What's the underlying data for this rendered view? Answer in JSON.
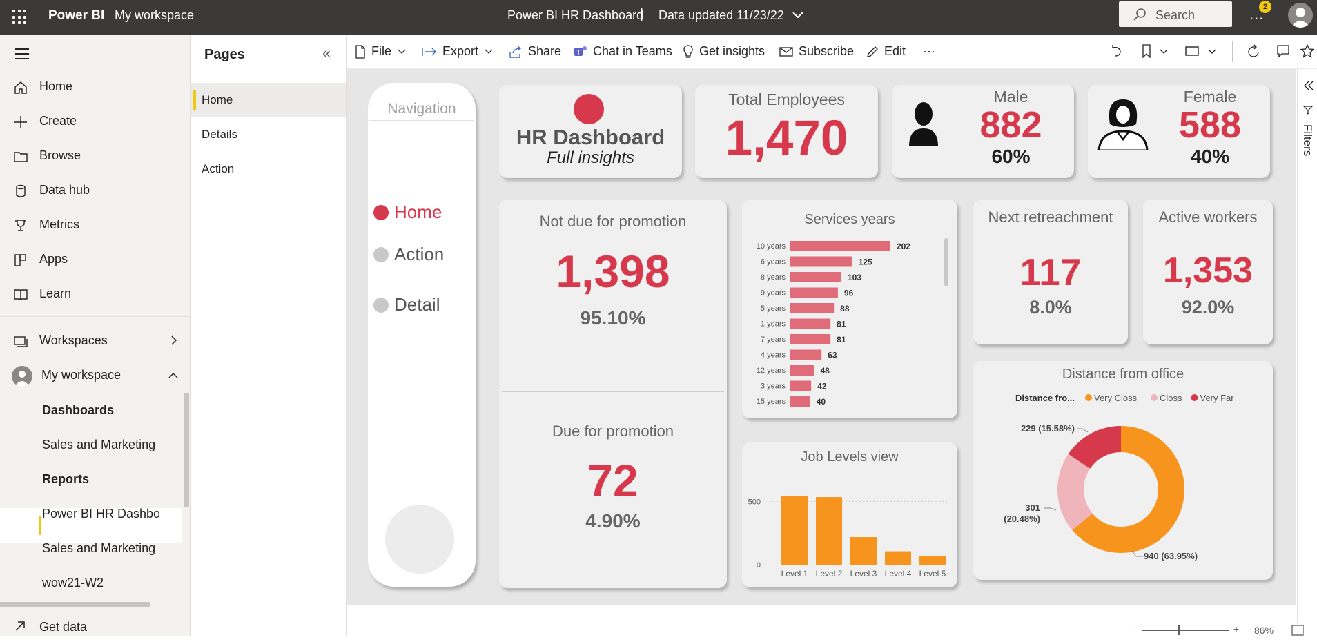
{
  "topbar": {
    "brand": "Power BI",
    "workspace": "My workspace",
    "report_title": "Power BI HR Dashboard",
    "separator": "|",
    "data_updated": "Data updated 11/23/22",
    "search_placeholder": "Search",
    "more": "...",
    "notification_count": "2"
  },
  "leftnav": {
    "items": [
      {
        "label": "Home",
        "icon": "home-icon"
      },
      {
        "label": "Create",
        "icon": "plus-icon"
      },
      {
        "label": "Browse",
        "icon": "folder-icon"
      },
      {
        "label": "Data hub",
        "icon": "database-icon"
      },
      {
        "label": "Metrics",
        "icon": "trophy-icon"
      },
      {
        "label": "Apps",
        "icon": "apps-icon"
      },
      {
        "label": "Learn",
        "icon": "book-icon"
      }
    ],
    "workspaces": "Workspaces",
    "my_workspace": "My workspace",
    "dashboards_header": "Dashboards",
    "dashboard_item": "Sales and Marketing S",
    "reports_header": "Reports",
    "report_items": [
      "Power BI HR Dashboa",
      "Sales and Marketing S",
      "wow21-W2"
    ],
    "get_data": "Get data"
  },
  "pages_pane": {
    "title": "Pages",
    "items": [
      "Home",
      "Details",
      "Action"
    ],
    "active": "Home"
  },
  "toolbar": {
    "file": "File",
    "export": "Export",
    "share": "Share",
    "chat": "Chat in Teams",
    "insights": "Get insights",
    "subscribe": "Subscribe",
    "edit": "Edit",
    "more": "···"
  },
  "filters_label": "Filters",
  "zoom": "86%",
  "report": {
    "navigation": {
      "title": "Navigation",
      "items": [
        "Home",
        "Action",
        "Detail"
      ],
      "active": "Home"
    },
    "title_card": {
      "title": "HR Dashboard",
      "subtitle": "Full insights"
    },
    "total_employees": {
      "label": "Total Employees",
      "value": "1,470"
    },
    "male": {
      "label": "Male",
      "value": "882",
      "pct": "60%"
    },
    "female": {
      "label": "Female",
      "value": "588",
      "pct": "40%"
    },
    "not_due": {
      "label": "Not due for promotion",
      "value": "1,398",
      "pct": "95.10%"
    },
    "due": {
      "label": "Due for promotion",
      "value": "72",
      "pct": "4.90%"
    },
    "retrenchment": {
      "label": "Next retreachment",
      "value": "117",
      "pct": "8.0%"
    },
    "active_workers": {
      "label": "Active workers",
      "value": "1,353",
      "pct": "92.0%"
    },
    "colors": {
      "accent_red": "#d6394c",
      "bar_pink": "#e06c7a",
      "bar_orange": "#f7941d",
      "light_pink": "#f0b4bb"
    }
  },
  "chart_data": [
    {
      "type": "bar",
      "orientation": "horizontal",
      "title": "Services years",
      "categories": [
        "10 years",
        "6 years",
        "8 years",
        "9 years",
        "5 years",
        "1 years",
        "7 years",
        "4 years",
        "12 years",
        "3 years",
        "15 years"
      ],
      "values": [
        202,
        125,
        103,
        96,
        88,
        81,
        81,
        63,
        48,
        42,
        40
      ]
    },
    {
      "type": "bar",
      "title": "Job Levels view",
      "categories": [
        "Level 1",
        "Level 2",
        "Level 3",
        "Level 4",
        "Level 5"
      ],
      "values": [
        543,
        534,
        218,
        106,
        69
      ],
      "y_ticks": [
        "500",
        "0"
      ],
      "ylim": [
        0,
        600
      ]
    },
    {
      "type": "pie",
      "title": "Distance from office",
      "legend_title": "Distance fro...",
      "legend": [
        {
          "name": "Very Closs",
          "color": "#f7941d"
        },
        {
          "name": "Closs",
          "color": "#f0b4bb"
        },
        {
          "name": "Very Far",
          "color": "#d6394c"
        }
      ],
      "slices": [
        {
          "name": "Very Closs",
          "value": 940,
          "label": "940 (63.95%)"
        },
        {
          "name": "Closs",
          "value": 301,
          "label_line1": "301",
          "label_line2": "(20.48%)"
        },
        {
          "name": "Very Far",
          "value": 229,
          "label": "229 (15.58%)"
        }
      ]
    }
  ]
}
